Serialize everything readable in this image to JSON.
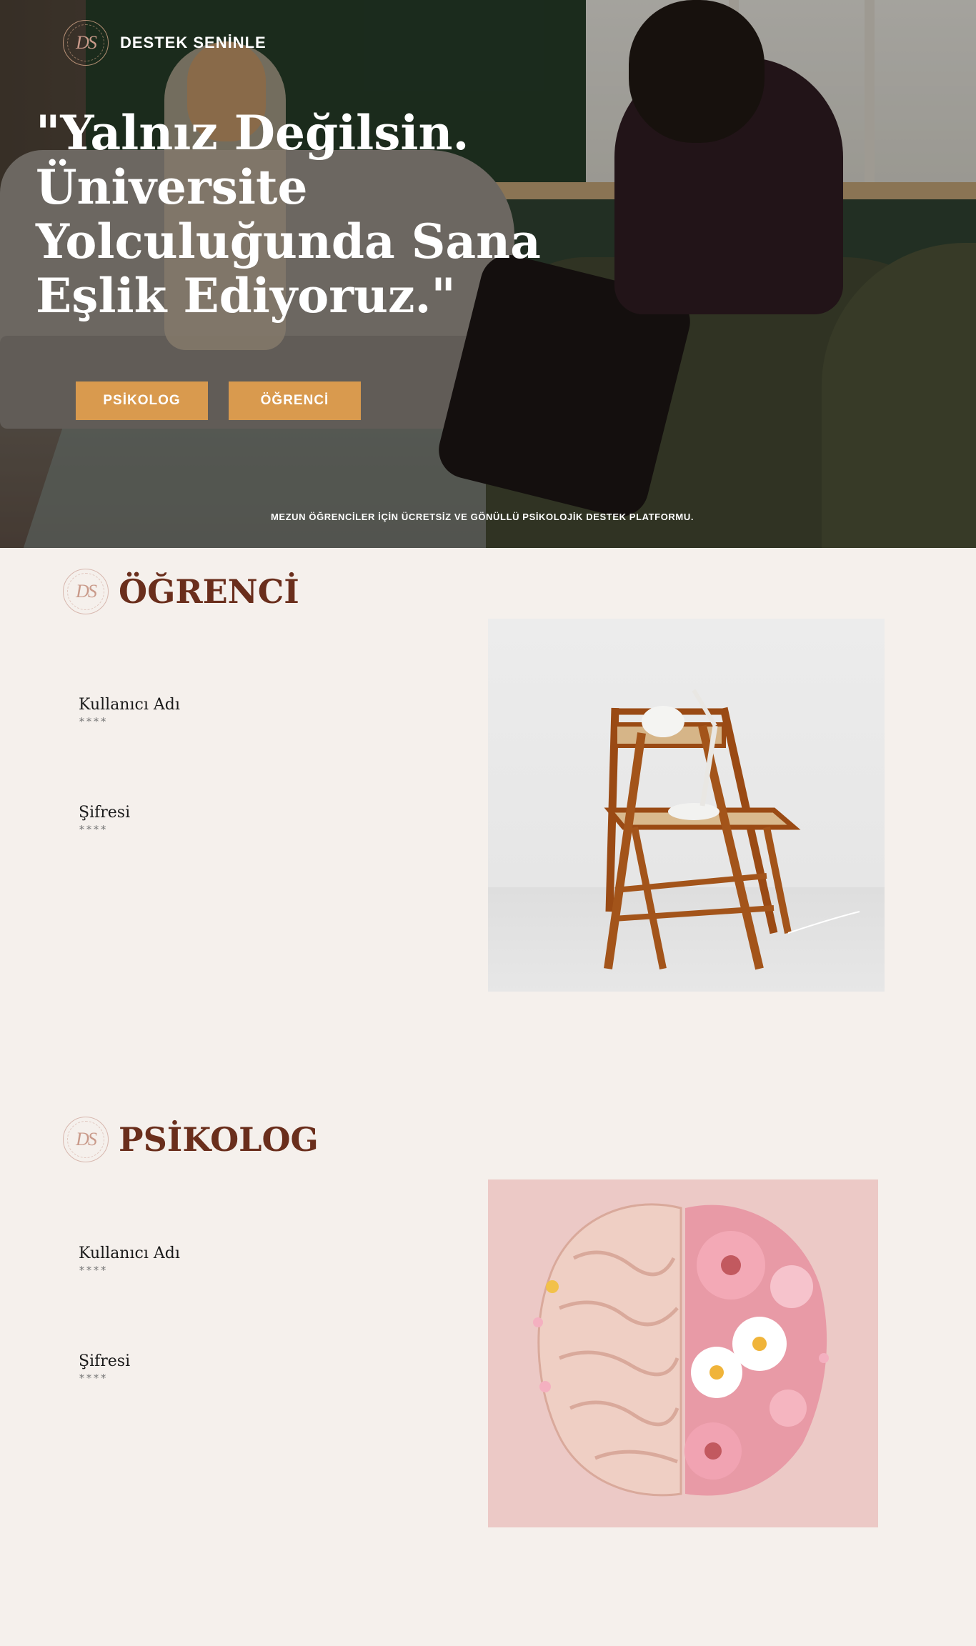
{
  "brand": {
    "logo_text": "DS",
    "name": "DESTEK SENİNLE"
  },
  "hero": {
    "title": "\"Yalnız Değilsin. Üniversite Yolculuğunda Sana Eşlik Ediyoruz.\"",
    "buttons": {
      "psikolog": "PSİKOLOG",
      "ogrenci": "ÖĞRENCİ"
    },
    "tagline": "MEZUN ÖĞRENCİLER İÇİN ÜCRETSİZ VE GÖNÜLLÜ PSİKOLOJİK DESTEK PLATFORMU."
  },
  "student": {
    "title": "ÖĞRENCİ",
    "username_label": "Kullanıcı Adı",
    "username_placeholder": "****",
    "password_label": "Şifresi",
    "password_placeholder": "****"
  },
  "psychologist": {
    "title": "PSİKOLOG",
    "username_label": "Kullanıcı Adı",
    "username_placeholder": "****",
    "password_label": "Şifresi",
    "password_placeholder": "****"
  },
  "colors": {
    "accent_button": "#d99a4e",
    "section_title": "#6a2e1c",
    "page_background": "#f5f0ec"
  }
}
